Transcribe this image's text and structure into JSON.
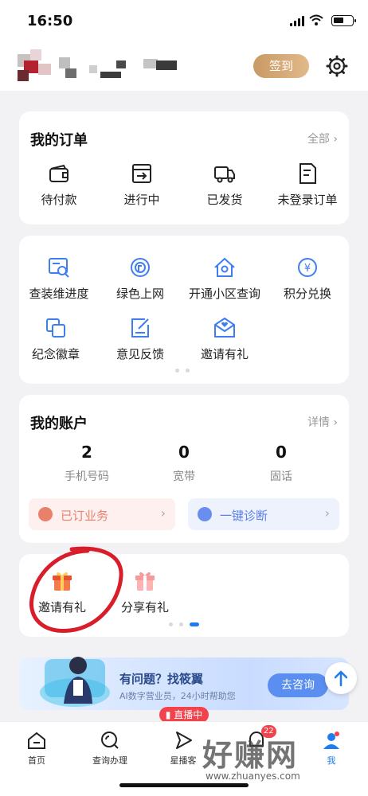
{
  "status_bar": {
    "time": "16:50"
  },
  "header": {
    "sign_in_label": "签到"
  },
  "orders": {
    "title": "我的订单",
    "more": "全部 ›",
    "items": [
      {
        "label": "待付款",
        "icon": "wallet-icon"
      },
      {
        "label": "进行中",
        "icon": "in-progress-icon"
      },
      {
        "label": "已发货",
        "icon": "truck-icon"
      },
      {
        "label": "未登录订单",
        "icon": "document-icon"
      }
    ]
  },
  "services": {
    "items": [
      {
        "label": "查装维进度",
        "icon": "progress-search-icon"
      },
      {
        "label": "绿色上网",
        "icon": "green-internet-icon"
      },
      {
        "label": "开通小区查询",
        "icon": "home-search-icon"
      },
      {
        "label": "积分兑换",
        "icon": "points-exchange-icon"
      },
      {
        "label": "纪念徽章",
        "icon": "badge-icon"
      },
      {
        "label": "意见反馈",
        "icon": "feedback-icon"
      },
      {
        "label": "邀请有礼",
        "icon": "invite-icon"
      }
    ]
  },
  "account": {
    "title": "我的账户",
    "more": "详情 ›",
    "stats": [
      {
        "value": "2",
        "label": "手机号码"
      },
      {
        "value": "0",
        "label": "宽带"
      },
      {
        "value": "0",
        "label": "固话"
      }
    ],
    "subscribed": "已订业务",
    "diagnose": "一键诊断"
  },
  "promo": {
    "items": [
      {
        "label": "邀请有礼",
        "icon": "gift-invite-icon"
      },
      {
        "label": "分享有礼",
        "icon": "gift-share-icon"
      }
    ]
  },
  "banner": {
    "title": "有问题？找筱翼",
    "subtitle": "AI数字营业员，24小时帮助您",
    "button": "去咨询",
    "live_badge": "直播中"
  },
  "tabbar": {
    "items": [
      {
        "label": "首页",
        "icon": "home-icon"
      },
      {
        "label": "查询办理",
        "icon": "query-icon"
      },
      {
        "label": "星播客",
        "icon": "star-podcast-icon"
      },
      {
        "label": "",
        "icon": "discover-icon",
        "badge": "22"
      },
      {
        "label": "我",
        "icon": "profile-icon"
      }
    ]
  },
  "watermark": {
    "text": "好赚网",
    "url": "www.zhuanyes.com"
  },
  "colors": {
    "accent": "#1e7cf0",
    "gold": "#d4a673",
    "red_annotation": "#d81e2a"
  }
}
